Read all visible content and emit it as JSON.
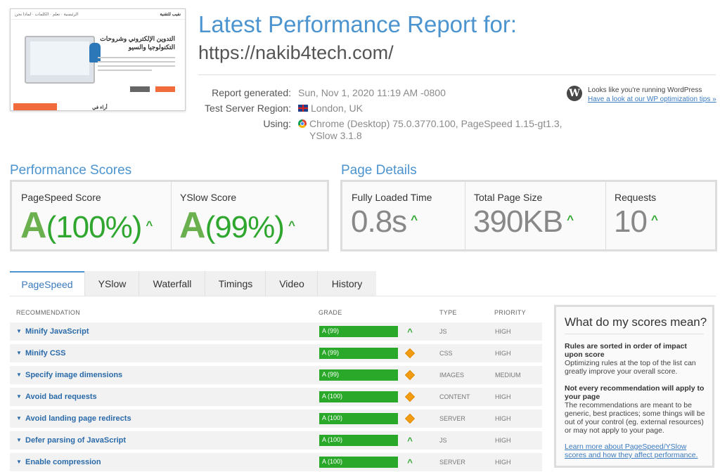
{
  "thumbnail": {
    "nav_items": [
      "الرئيسية",
      "تعلم",
      "الكلمات",
      "لماذا نحن"
    ],
    "brand": "نقيب للتقنية",
    "headline": "التدوين الإلكتروني وشروحات التكنولوجيا والسيو",
    "bottom_text": "أراء في"
  },
  "header": {
    "title": "Latest Performance Report for:",
    "url": "https://nakib4tech.com/"
  },
  "meta": {
    "generated_label": "Report generated:",
    "generated_value": "Sun, Nov 1, 2020 11:19 AM -0800",
    "region_label": "Test Server Region:",
    "region_value": "London, UK",
    "using_label": "Using:",
    "using_value_line1": "Chrome (Desktop) 75.0.3770.100, PageSpeed 1.15-gt1.3,",
    "using_value_line2": "YSlow 3.1.8"
  },
  "wordpress": {
    "line1": "Looks like you're running WordPress",
    "line2": "Have a look at our WP optimization tips »"
  },
  "performance": {
    "title": "Performance Scores",
    "pagespeed": {
      "label": "PageSpeed Score",
      "grade": "A",
      "pct": "(100%)"
    },
    "yslow": {
      "label": "YSlow Score",
      "grade": "A",
      "pct": "(99%)"
    }
  },
  "details": {
    "title": "Page Details",
    "load": {
      "label": "Fully Loaded Time",
      "value": "0.8s"
    },
    "size": {
      "label": "Total Page Size",
      "value": "390KB"
    },
    "requests": {
      "label": "Requests",
      "value": "10"
    }
  },
  "tabs": [
    "PageSpeed",
    "YSlow",
    "Waterfall",
    "Timings",
    "Video",
    "History"
  ],
  "table": {
    "headers": {
      "recommendation": "RECOMMENDATION",
      "grade": "GRADE",
      "type": "TYPE",
      "priority": "PRIORITY"
    },
    "rows": [
      {
        "name": "Minify JavaScript",
        "grade": "A (99)",
        "indicator": "up",
        "type": "JS",
        "priority": "HIGH"
      },
      {
        "name": "Minify CSS",
        "grade": "A (99)",
        "indicator": "diamond",
        "type": "CSS",
        "priority": "HIGH"
      },
      {
        "name": "Specify image dimensions",
        "grade": "A (99)",
        "indicator": "diamond",
        "type": "IMAGES",
        "priority": "MEDIUM"
      },
      {
        "name": "Avoid bad requests",
        "grade": "A (100)",
        "indicator": "diamond",
        "type": "CONTENT",
        "priority": "HIGH"
      },
      {
        "name": "Avoid landing page redirects",
        "grade": "A (100)",
        "indicator": "diamond",
        "type": "SERVER",
        "priority": "HIGH"
      },
      {
        "name": "Defer parsing of JavaScript",
        "grade": "A (100)",
        "indicator": "up",
        "type": "JS",
        "priority": "HIGH"
      },
      {
        "name": "Enable compression",
        "grade": "A (100)",
        "indicator": "up",
        "type": "SERVER",
        "priority": "HIGH"
      }
    ]
  },
  "infobox": {
    "title": "What do my scores mean?",
    "p1_bold": "Rules are sorted in order of impact upon score",
    "p1_text": "Optimizing rules at the top of the list can greatly improve your overall score.",
    "p2_bold": "Not every recommendation will apply to your page",
    "p2_text": "The recommendations are meant to be generic, best practices; some things will be out of your control (eg. external resources) or may not apply to your page.",
    "link": "Learn more about PageSpeed/YSlow scores and how they affect performance."
  },
  "colors": {
    "accent": "#4c94cf",
    "grade_green": "#2aa82a",
    "warning": "#f39c12"
  }
}
